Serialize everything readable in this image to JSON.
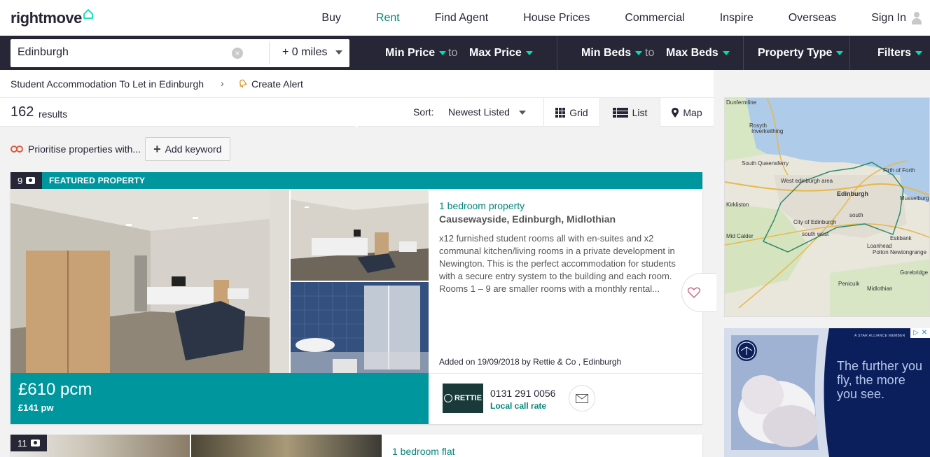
{
  "brand": {
    "name": "rightmove",
    "accent": "#00deb6"
  },
  "nav": {
    "items": [
      "Buy",
      "Rent",
      "Find Agent",
      "House Prices",
      "Commercial",
      "Inspire",
      "Overseas"
    ],
    "active": "Rent",
    "signin": "Sign In"
  },
  "search": {
    "location": "Edinburgh",
    "radius": "+ 0 miles",
    "min_price": "Min Price",
    "to1": "to",
    "max_price": "Max Price",
    "min_beds": "Min Beds",
    "to2": "to",
    "max_beds": "Max Beds",
    "property_type": "Property Type",
    "filters": "Filters"
  },
  "breadcrumb": {
    "title": "Student Accommodation To Let in Edinburgh",
    "create_alert": "Create Alert"
  },
  "results": {
    "count": "162",
    "label": "results",
    "sort_label": "Sort:",
    "sort_value": "Newest Listed",
    "views": {
      "grid": "Grid",
      "list": "List",
      "map": "Map"
    },
    "active_view": "List"
  },
  "keywords": {
    "prioritise": "Prioritise properties with...",
    "add": "Add keyword"
  },
  "listings": [
    {
      "photo_count": "9",
      "badge": "FEATURED PROPERTY",
      "type": "1 bedroom property",
      "address": "Causewayside, Edinburgh, Midlothian",
      "description": "x12 furnished student rooms all with en-suites and x2 communal kitchen/living rooms in a private development in Newington. This is the perfect accommodation for students with a secure entry system to the building and each room. Rooms 1 – 9 are smaller rooms with a monthly rental...",
      "added": "Added on 19/09/2018 by Rettie & Co , Edinburgh",
      "price_pcm": "£610 pcm",
      "price_pw": "£141 pw",
      "agent_logo": "RETTIE",
      "phone": "0131 291 0056",
      "local_call": "Local call rate"
    },
    {
      "photo_count": "11",
      "type": "1 bedroom flat"
    }
  ],
  "map": {
    "labels": [
      "Dunfermline",
      "Rosyth",
      "Inverkeithing",
      "South Queensferry",
      "Firth of Forth",
      "West edinburgh area",
      "Edinburgh",
      "Musselburgh",
      "Kirkliston",
      "south",
      "City of Edinburgh",
      "south west",
      "Mid Calder",
      "Eskbank",
      "Loanhead",
      "Polton",
      "Newtongrange",
      "Gorebridge",
      "Penicuik",
      "Midlothian"
    ]
  },
  "ad": {
    "text": "The further you fly, the more you see.",
    "small": "A STAR ALLIANCE MEMBER"
  }
}
